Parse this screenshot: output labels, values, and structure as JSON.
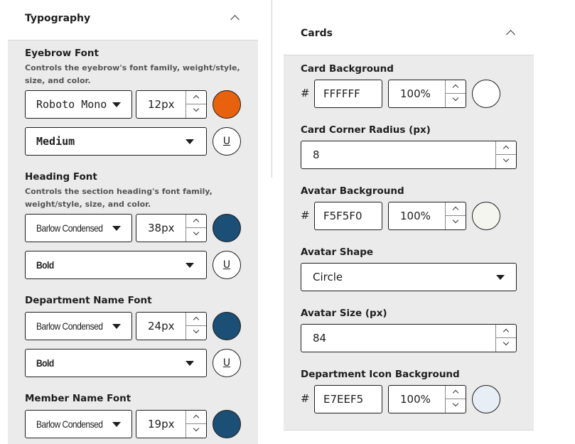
{
  "typography": {
    "title": "Typography",
    "eyebrow": {
      "label": "Eyebrow Font",
      "help_line1": "Controls the eyebrow's font family, weight/style,",
      "help_line2": "size, and color.",
      "family": "Roboto Mono",
      "size": "12px",
      "color": "#e8620e",
      "weight": "Medium",
      "underline_label": "U"
    },
    "heading": {
      "label": "Heading Font",
      "help_line1": "Controls the section heading's font family,",
      "help_line2": "weight/style, size, and color.",
      "family": "Barlow Condensed",
      "size": "38px",
      "color": "#1b4f75",
      "weight": "Bold",
      "underline_label": "U"
    },
    "department": {
      "label": "Department Name Font",
      "family": "Barlow Condensed",
      "size": "24px",
      "color": "#1b4f75",
      "weight": "Bold",
      "underline_label": "U"
    },
    "member": {
      "label": "Member Name Font",
      "family": "Barlow Condensed",
      "size": "19px",
      "color": "#1b4f75"
    }
  },
  "cards": {
    "title": "Cards",
    "hash_symbol": "#",
    "card_background": {
      "label": "Card Background",
      "hex": "FFFFFF",
      "opacity": "100%",
      "color": "#ffffff"
    },
    "corner_radius": {
      "label": "Card Corner Radius (px)",
      "value": "8"
    },
    "avatar_background": {
      "label": "Avatar Background",
      "hex": "F5F5F0",
      "opacity": "100%",
      "color": "#f5f5f0"
    },
    "avatar_shape": {
      "label": "Avatar Shape",
      "value": "Circle"
    },
    "avatar_size": {
      "label": "Avatar Size (px)",
      "value": "84"
    },
    "dept_icon_background": {
      "label": "Department Icon Background",
      "hex": "E7EEF5",
      "opacity": "100%",
      "color": "#e7eef5"
    }
  }
}
